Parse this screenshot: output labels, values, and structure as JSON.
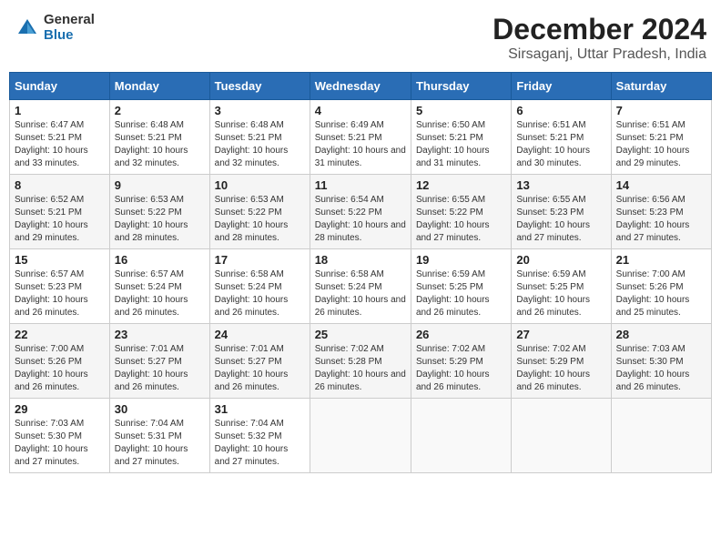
{
  "logo": {
    "general": "General",
    "blue": "Blue"
  },
  "header": {
    "title": "December 2024",
    "subtitle": "Sirsaganj, Uttar Pradesh, India"
  },
  "weekdays": [
    "Sunday",
    "Monday",
    "Tuesday",
    "Wednesday",
    "Thursday",
    "Friday",
    "Saturday"
  ],
  "weeks": [
    [
      {
        "day": "1",
        "sunrise": "6:47 AM",
        "sunset": "5:21 PM",
        "daylight": "10 hours and 33 minutes."
      },
      {
        "day": "2",
        "sunrise": "6:48 AM",
        "sunset": "5:21 PM",
        "daylight": "10 hours and 32 minutes."
      },
      {
        "day": "3",
        "sunrise": "6:48 AM",
        "sunset": "5:21 PM",
        "daylight": "10 hours and 32 minutes."
      },
      {
        "day": "4",
        "sunrise": "6:49 AM",
        "sunset": "5:21 PM",
        "daylight": "10 hours and 31 minutes."
      },
      {
        "day": "5",
        "sunrise": "6:50 AM",
        "sunset": "5:21 PM",
        "daylight": "10 hours and 31 minutes."
      },
      {
        "day": "6",
        "sunrise": "6:51 AM",
        "sunset": "5:21 PM",
        "daylight": "10 hours and 30 minutes."
      },
      {
        "day": "7",
        "sunrise": "6:51 AM",
        "sunset": "5:21 PM",
        "daylight": "10 hours and 29 minutes."
      }
    ],
    [
      {
        "day": "8",
        "sunrise": "6:52 AM",
        "sunset": "5:21 PM",
        "daylight": "10 hours and 29 minutes."
      },
      {
        "day": "9",
        "sunrise": "6:53 AM",
        "sunset": "5:22 PM",
        "daylight": "10 hours and 28 minutes."
      },
      {
        "day": "10",
        "sunrise": "6:53 AM",
        "sunset": "5:22 PM",
        "daylight": "10 hours and 28 minutes."
      },
      {
        "day": "11",
        "sunrise": "6:54 AM",
        "sunset": "5:22 PM",
        "daylight": "10 hours and 28 minutes."
      },
      {
        "day": "12",
        "sunrise": "6:55 AM",
        "sunset": "5:22 PM",
        "daylight": "10 hours and 27 minutes."
      },
      {
        "day": "13",
        "sunrise": "6:55 AM",
        "sunset": "5:23 PM",
        "daylight": "10 hours and 27 minutes."
      },
      {
        "day": "14",
        "sunrise": "6:56 AM",
        "sunset": "5:23 PM",
        "daylight": "10 hours and 27 minutes."
      }
    ],
    [
      {
        "day": "15",
        "sunrise": "6:57 AM",
        "sunset": "5:23 PM",
        "daylight": "10 hours and 26 minutes."
      },
      {
        "day": "16",
        "sunrise": "6:57 AM",
        "sunset": "5:24 PM",
        "daylight": "10 hours and 26 minutes."
      },
      {
        "day": "17",
        "sunrise": "6:58 AM",
        "sunset": "5:24 PM",
        "daylight": "10 hours and 26 minutes."
      },
      {
        "day": "18",
        "sunrise": "6:58 AM",
        "sunset": "5:24 PM",
        "daylight": "10 hours and 26 minutes."
      },
      {
        "day": "19",
        "sunrise": "6:59 AM",
        "sunset": "5:25 PM",
        "daylight": "10 hours and 26 minutes."
      },
      {
        "day": "20",
        "sunrise": "6:59 AM",
        "sunset": "5:25 PM",
        "daylight": "10 hours and 26 minutes."
      },
      {
        "day": "21",
        "sunrise": "7:00 AM",
        "sunset": "5:26 PM",
        "daylight": "10 hours and 25 minutes."
      }
    ],
    [
      {
        "day": "22",
        "sunrise": "7:00 AM",
        "sunset": "5:26 PM",
        "daylight": "10 hours and 26 minutes."
      },
      {
        "day": "23",
        "sunrise": "7:01 AM",
        "sunset": "5:27 PM",
        "daylight": "10 hours and 26 minutes."
      },
      {
        "day": "24",
        "sunrise": "7:01 AM",
        "sunset": "5:27 PM",
        "daylight": "10 hours and 26 minutes."
      },
      {
        "day": "25",
        "sunrise": "7:02 AM",
        "sunset": "5:28 PM",
        "daylight": "10 hours and 26 minutes."
      },
      {
        "day": "26",
        "sunrise": "7:02 AM",
        "sunset": "5:29 PM",
        "daylight": "10 hours and 26 minutes."
      },
      {
        "day": "27",
        "sunrise": "7:02 AM",
        "sunset": "5:29 PM",
        "daylight": "10 hours and 26 minutes."
      },
      {
        "day": "28",
        "sunrise": "7:03 AM",
        "sunset": "5:30 PM",
        "daylight": "10 hours and 26 minutes."
      }
    ],
    [
      {
        "day": "29",
        "sunrise": "7:03 AM",
        "sunset": "5:30 PM",
        "daylight": "10 hours and 27 minutes."
      },
      {
        "day": "30",
        "sunrise": "7:04 AM",
        "sunset": "5:31 PM",
        "daylight": "10 hours and 27 minutes."
      },
      {
        "day": "31",
        "sunrise": "7:04 AM",
        "sunset": "5:32 PM",
        "daylight": "10 hours and 27 minutes."
      },
      null,
      null,
      null,
      null
    ]
  ],
  "labels": {
    "sunrise": "Sunrise: ",
    "sunset": "Sunset: ",
    "daylight": "Daylight: "
  }
}
